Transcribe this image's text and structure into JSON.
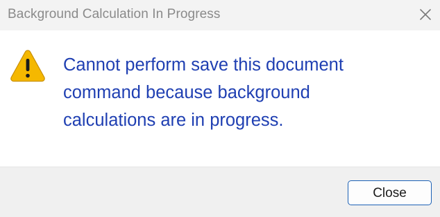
{
  "window": {
    "title": "Background Calculation In Progress"
  },
  "message": {
    "line1": "Cannot perform save this document",
    "line2": "command because background",
    "line3": "calculations are in progress."
  },
  "buttons": {
    "close_label": "Close"
  },
  "icons": {
    "message_icon": "warning-icon",
    "titlebar_close": "close-icon"
  },
  "colors": {
    "message_text": "#1f3fb2",
    "warning_fill": "#f5b800",
    "button_border": "#1a5fb4",
    "titlebar_bg": "#f3f3f3",
    "footer_bg": "#f0f0f0"
  }
}
